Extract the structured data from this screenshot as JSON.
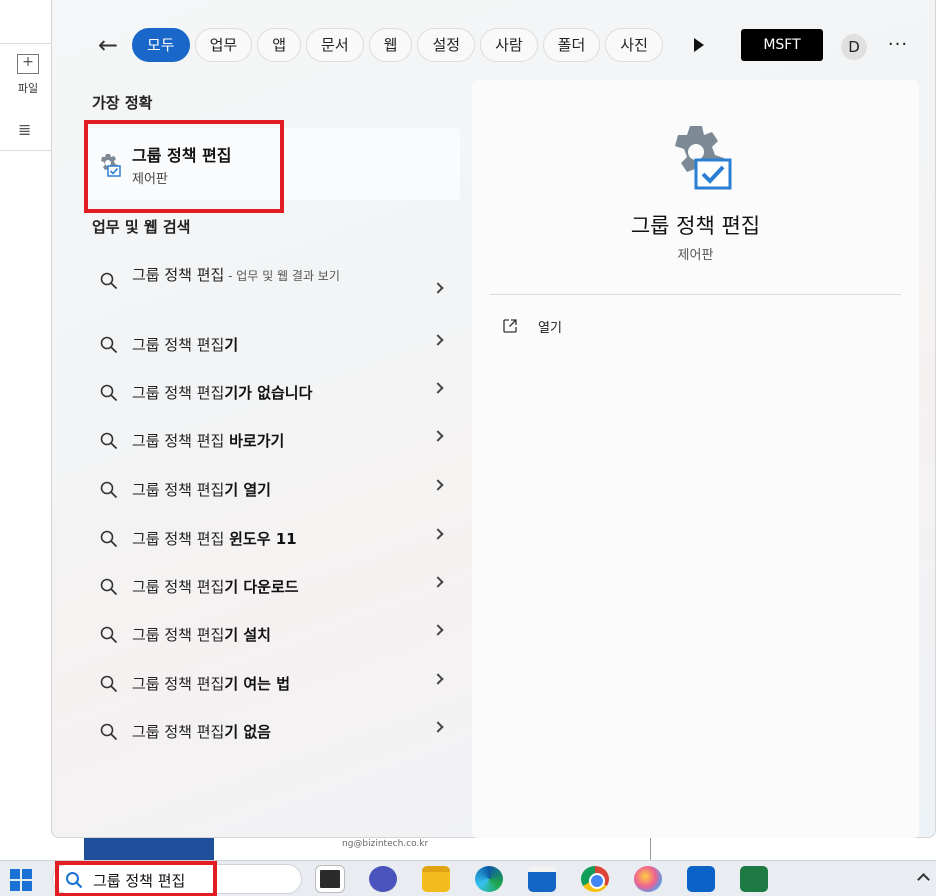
{
  "background_app": {
    "file_button_label": "파일",
    "doc_email": "ng@bizintech.co.kr"
  },
  "search_panel": {
    "filters": [
      "모두",
      "업무",
      "앱",
      "문서",
      "웹",
      "설정",
      "사람",
      "폴더",
      "사진"
    ],
    "active_filter": "모두",
    "account_label": "MSFT",
    "avatar_initial": "D",
    "more_label": "···"
  },
  "best_match": {
    "section_title": "가장 정확",
    "name": "그룹 정책 편집",
    "subtitle": "제어판"
  },
  "web_search": {
    "section_title": "업무 및 웹 검색",
    "results": [
      {
        "prefix": "그룹 정책 편집",
        "bold": "",
        "hint": " - 업무 및 웹 결과 보기"
      },
      {
        "prefix": "그룹 정책 편집",
        "bold": "기",
        "hint": ""
      },
      {
        "prefix": "그룹 정책 편집",
        "bold": "기가 없습니다",
        "hint": ""
      },
      {
        "prefix": "그룹 정책 편집 ",
        "bold": "바로가기",
        "hint": ""
      },
      {
        "prefix": "그룹 정책 편집",
        "bold": "기 열기",
        "hint": ""
      },
      {
        "prefix": "그룹 정책 편집 ",
        "bold": "윈도우 11",
        "hint": ""
      },
      {
        "prefix": "그룹 정책 편집",
        "bold": "기 다운로드",
        "hint": ""
      },
      {
        "prefix": "그룹 정책 편집",
        "bold": "기 설치",
        "hint": ""
      },
      {
        "prefix": "그룹 정책 편집",
        "bold": "기 여는 법",
        "hint": ""
      },
      {
        "prefix": "그룹 정책 편집",
        "bold": "기 없음",
        "hint": ""
      }
    ]
  },
  "preview": {
    "title": "그룹 정책 편집",
    "subtitle": "제어판",
    "open_label": "열기"
  },
  "taskbar": {
    "search_value": "그룹 정책 편집",
    "apps": [
      "task-view",
      "teams-meet",
      "file-explorer",
      "edge",
      "microsoft-store",
      "chrome",
      "paint",
      "outlook",
      "excel"
    ]
  },
  "colors": {
    "accent": "#1967c9",
    "highlight_red": "#e31b23"
  }
}
